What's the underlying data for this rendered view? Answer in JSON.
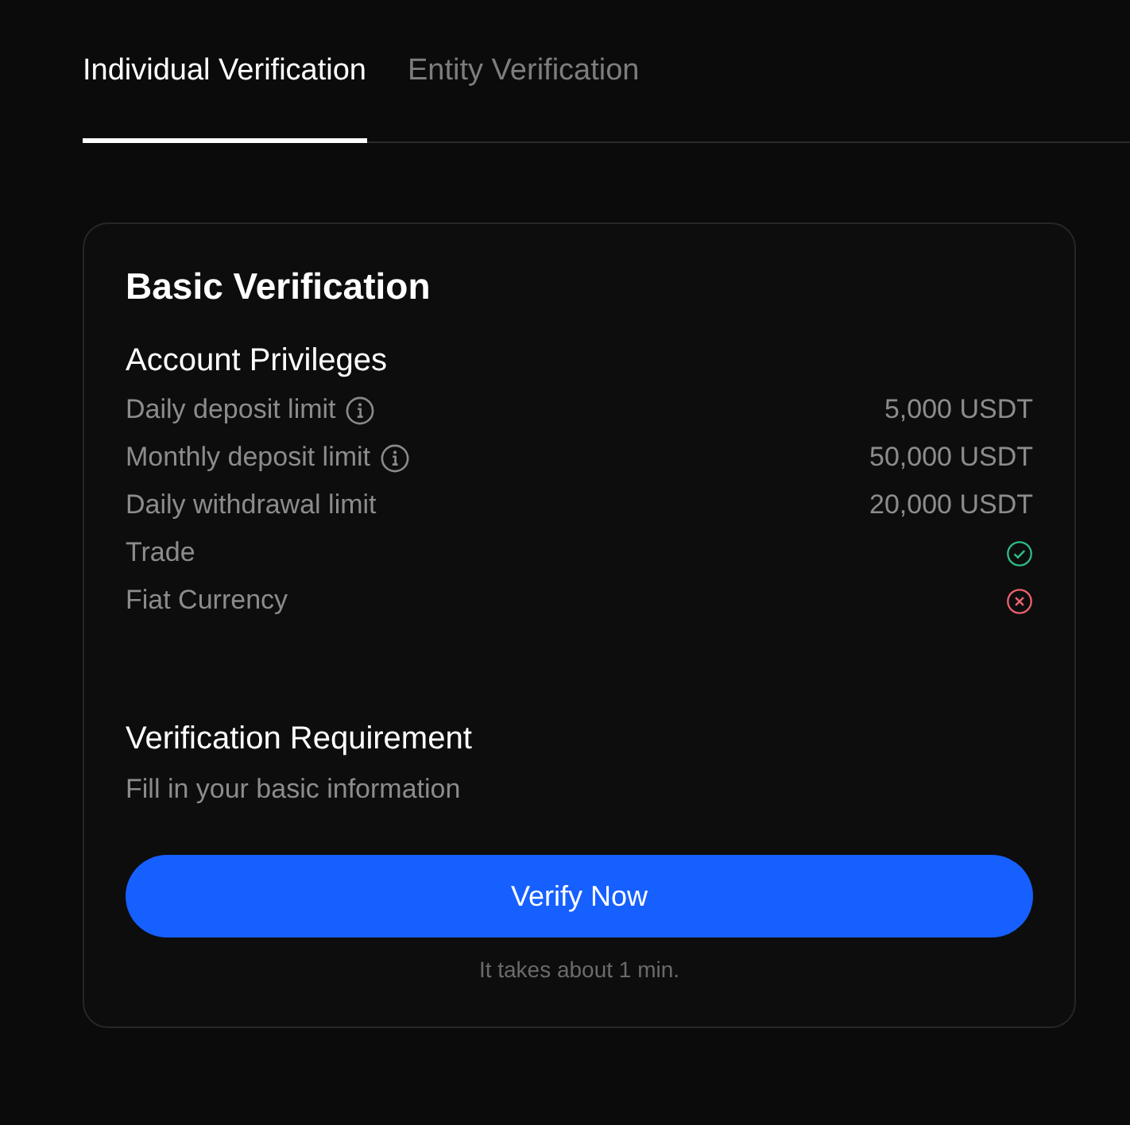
{
  "tabs": [
    {
      "label": "Individual Verification",
      "selected": true
    },
    {
      "label": "Entity Verification",
      "selected": false
    }
  ],
  "card": {
    "title": "Basic Verification",
    "privileges_title": "Account Privileges",
    "privileges": [
      {
        "kind": "value",
        "label": "Daily deposit limit",
        "info": true,
        "value": "5,000 USDT"
      },
      {
        "kind": "value",
        "label": "Monthly deposit limit",
        "info": true,
        "value": "50,000 USDT"
      },
      {
        "kind": "value",
        "label": "Daily withdrawal limit",
        "info": false,
        "value": "20,000 USDT"
      },
      {
        "kind": "status",
        "label": "Trade",
        "allowed": true
      },
      {
        "kind": "status",
        "label": "Fiat Currency",
        "allowed": false
      }
    ],
    "requirement_title": "Verification Requirement",
    "requirement": "Fill in your basic information",
    "button": "Verify Now",
    "note": "It takes about 1 min."
  }
}
